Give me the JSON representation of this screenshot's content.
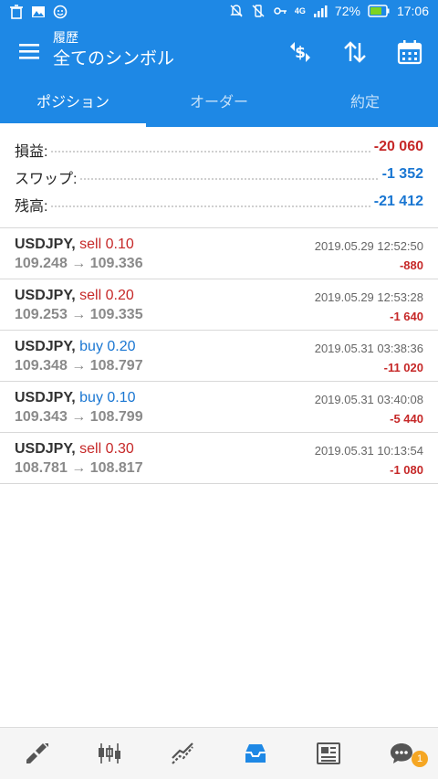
{
  "status_bar": {
    "battery_percent": "72%",
    "time": "17:06",
    "network": "4G"
  },
  "app_bar": {
    "subtitle": "履歴",
    "title": "全てのシンボル"
  },
  "tabs": [
    {
      "label": "ポジション",
      "active": true
    },
    {
      "label": "オーダー",
      "active": false
    },
    {
      "label": "約定",
      "active": false
    }
  ],
  "summary": {
    "profit": {
      "label": "損益:",
      "value": "-20 060"
    },
    "swap": {
      "label": "スワップ:",
      "value": "-1 352"
    },
    "balance": {
      "label": "残高:",
      "value": "-21 412"
    }
  },
  "positions": [
    {
      "symbol": "USDJPY,",
      "side": "sell",
      "volume": "0.10",
      "open": "109.248",
      "close": "109.336",
      "arrow": "→",
      "time": "2019.05.29 12:52:50",
      "profit": "-880"
    },
    {
      "symbol": "USDJPY,",
      "side": "sell",
      "volume": "0.20",
      "open": "109.253",
      "close": "109.335",
      "arrow": "→",
      "time": "2019.05.29 12:53:28",
      "profit": "-1 640"
    },
    {
      "symbol": "USDJPY,",
      "side": "buy",
      "volume": "0.20",
      "open": "109.348",
      "close": "108.797",
      "arrow": "→",
      "time": "2019.05.31 03:38:36",
      "profit": "-11 020"
    },
    {
      "symbol": "USDJPY,",
      "side": "buy",
      "volume": "0.10",
      "open": "109.343",
      "close": "108.799",
      "arrow": "→",
      "time": "2019.05.31 03:40:08",
      "profit": "-5 440"
    },
    {
      "symbol": "USDJPY,",
      "side": "sell",
      "volume": "0.30",
      "open": "108.781",
      "close": "108.817",
      "arrow": "→",
      "time": "2019.05.31 10:13:54",
      "profit": "-1 080"
    }
  ],
  "bottom_nav": [
    {
      "icon": "quotes-icon",
      "active": false
    },
    {
      "icon": "chart-icon",
      "active": false
    },
    {
      "icon": "trade-icon",
      "active": false
    },
    {
      "icon": "history-icon",
      "active": true
    },
    {
      "icon": "news-icon",
      "active": false
    },
    {
      "icon": "chat-icon",
      "active": false,
      "badge": "1"
    }
  ],
  "colors": {
    "primary": "#1e88e5",
    "negative": "#c62828",
    "blue_value": "#1976d2",
    "badge": "#f5a623"
  }
}
